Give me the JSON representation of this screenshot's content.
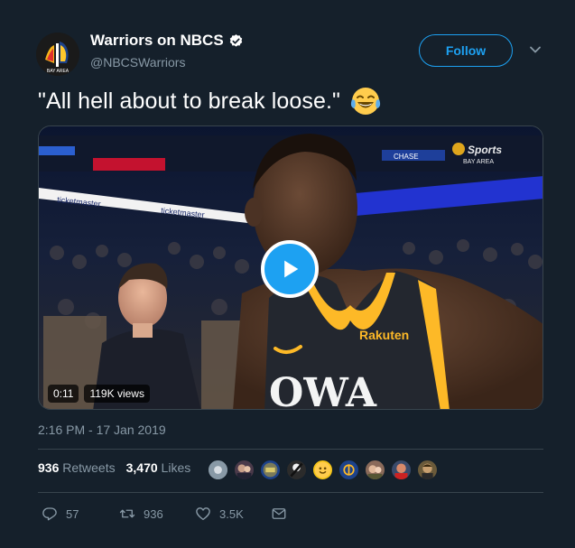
{
  "account": {
    "display_name": "Warriors on NBCS",
    "handle": "@NBCSWarriors",
    "verified": true,
    "avatar_icon": "nbc-sports-warriors-logo"
  },
  "follow_label": "Follow",
  "tweet": {
    "text": "\"All hell about to break loose.\"",
    "emoji": "face-with-tears-of-joy"
  },
  "media": {
    "duration": "0:11",
    "views": "119K views",
    "watermark": "NBC Sports Bay Area",
    "jersey_text": "Rakuten",
    "signage": [
      "ticketmaster",
      "ticketmaster",
      "CHASE"
    ]
  },
  "timestamp": "2:16 PM - 17 Jan 2019",
  "stats": {
    "retweets_count": "936",
    "retweets_label": "Retweets",
    "likes_count": "3,470",
    "likes_label": "Likes",
    "liker_avatars": 9
  },
  "actions": {
    "reply_count": "57",
    "retweet_count": "936",
    "like_count": "3.5K"
  },
  "colors": {
    "background": "#15202b",
    "accent": "#1da1f2",
    "secondary_text": "#8899a6",
    "divider": "#38444d"
  }
}
